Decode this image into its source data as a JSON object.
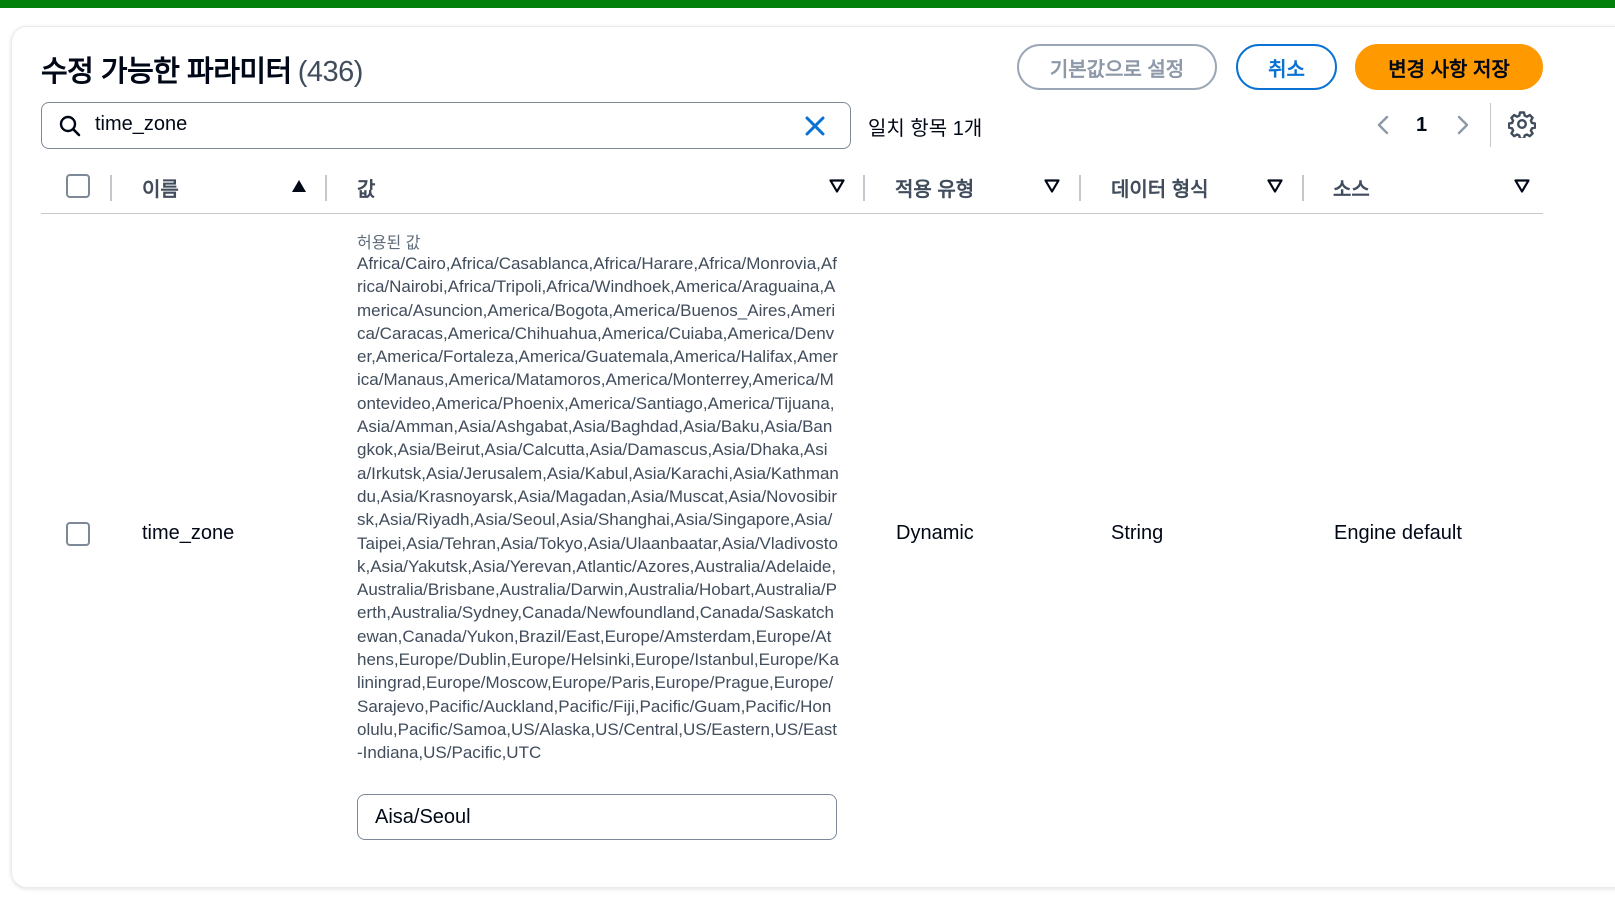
{
  "header": {
    "title": "수정 가능한 파라미터",
    "count": "(436)",
    "reset_label": "기본값으로 설정",
    "cancel_label": "취소",
    "save_label": "변경 사항 저장"
  },
  "search": {
    "value": "time_zone",
    "icon": "search-icon",
    "clear_icon": "close-icon"
  },
  "match_count": "일치 항목 1개",
  "pagination": {
    "current_page": "1"
  },
  "table": {
    "columns": [
      {
        "label": "이름",
        "sort": "ascending"
      },
      {
        "label": "값",
        "sort": "none"
      },
      {
        "label": "적용 유형",
        "sort": "none"
      },
      {
        "label": "데이터 형식",
        "sort": "none"
      },
      {
        "label": "소스",
        "sort": "none"
      }
    ],
    "rows": [
      {
        "name": "time_zone",
        "allowed_caption": "허용된 값",
        "allowed_values": "Africa/Cairo,Africa/Casablanca,Africa/Harare,Africa/Monrovia,Africa/Nairobi,Africa/Tripoli,Africa/Windhoek,America/Araguaina,America/Asuncion,America/Bogota,America/Buenos_Aires,America/Caracas,America/Chihuahua,America/Cuiaba,America/Denver,America/Fortaleza,America/Guatemala,America/Halifax,America/Manaus,America/Matamoros,America/Monterrey,America/Montevideo,America/Phoenix,America/Santiago,America/Tijuana,Asia/Amman,Asia/Ashgabat,Asia/Baghdad,Asia/Baku,Asia/Bangkok,Asia/Beirut,Asia/Calcutta,Asia/Damascus,Asia/Dhaka,Asia/Irkutsk,Asia/Jerusalem,Asia/Kabul,Asia/Karachi,Asia/Kathmandu,Asia/Krasnoyarsk,Asia/Magadan,Asia/Muscat,Asia/Novosibirsk,Asia/Riyadh,Asia/Seoul,Asia/Shanghai,Asia/Singapore,Asia/Taipei,Asia/Tehran,Asia/Tokyo,Asia/Ulaanbaatar,Asia/Vladivostok,Asia/Yakutsk,Asia/Yerevan,Atlantic/Azores,Australia/Adelaide,Australia/Brisbane,Australia/Darwin,Australia/Hobart,Australia/Perth,Australia/Sydney,Canada/Newfoundland,Canada/Saskatchewan,Canada/Yukon,Brazil/East,Europe/Amsterdam,Europe/Athens,Europe/Dublin,Europe/Helsinki,Europe/Istanbul,Europe/Kaliningrad,Europe/Moscow,Europe/Paris,Europe/Prague,Europe/Sarajevo,Pacific/Auckland,Pacific/Fiji,Pacific/Guam,Pacific/Honolulu,Pacific/Samoa,US/Alaska,US/Central,US/Eastern,US/East-Indiana,US/Pacific,UTC",
        "value": "Aisa/Seoul",
        "apply_type": "Dynamic",
        "data_type": "String",
        "source": "Engine default",
        "selected": false
      }
    ]
  },
  "colors": {
    "top_strip": "#037f0c",
    "primary_button": "#ff9900",
    "link_blue": "#0972d3",
    "disabled_gray": "#8d99a8"
  },
  "icons": [
    "search-icon",
    "close-icon",
    "chevron-left-icon",
    "chevron-right-icon",
    "gear-icon",
    "sort-ascending-icon",
    "sort-descending-icon"
  ]
}
